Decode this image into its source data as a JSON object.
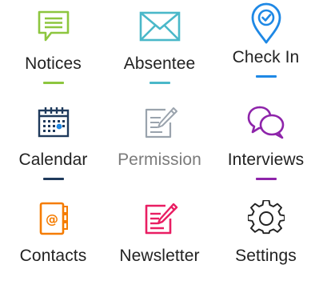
{
  "tiles": [
    {
      "label": "Notices",
      "icon": "notice-icon",
      "color": "#8dc63f",
      "underline": "#8dc63f"
    },
    {
      "label": "Absentee",
      "icon": "envelope-icon",
      "color": "#4ab8c9",
      "underline": "#4ab8c9"
    },
    {
      "label": "Check In",
      "icon": "location-pin-icon",
      "color": "#1e88e5",
      "underline": "#1e88e5"
    },
    {
      "label": "Calendar",
      "icon": "calendar-icon",
      "color": "#1f3a5c",
      "underline": "#1f3a5c"
    },
    {
      "label": "Permission",
      "icon": "form-edit-icon",
      "color": "#9aa3ad",
      "underline": ""
    },
    {
      "label": "Interviews",
      "icon": "chat-bubbles-icon",
      "color": "#8e24aa",
      "underline": "#8e24aa"
    },
    {
      "label": "Contacts",
      "icon": "address-book-icon",
      "color": "#f57c00",
      "underline": ""
    },
    {
      "label": "Newsletter",
      "icon": "newsletter-edit-icon",
      "color": "#e91e63",
      "underline": ""
    },
    {
      "label": "Settings",
      "icon": "gear-icon",
      "color": "#222222",
      "underline": ""
    }
  ]
}
